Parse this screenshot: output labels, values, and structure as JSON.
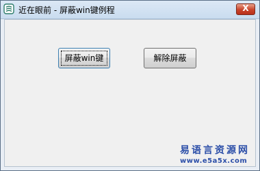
{
  "window": {
    "title": "近在眼前 - 屏蔽win键例程",
    "close_label": "X"
  },
  "buttons": {
    "block_label": "屏蔽win键",
    "unblock_label": "解除屏蔽"
  },
  "watermark": {
    "line1": "易语言资源网",
    "line2": "www.e5a5x.com"
  },
  "colors": {
    "title_bar": "#dce8f5",
    "close_button": "#c8432a",
    "watermark": "#2b4ea8",
    "client_bg": "#f0f0f0"
  },
  "icons": {
    "app": "swirl-app-icon",
    "close": "close-icon"
  }
}
